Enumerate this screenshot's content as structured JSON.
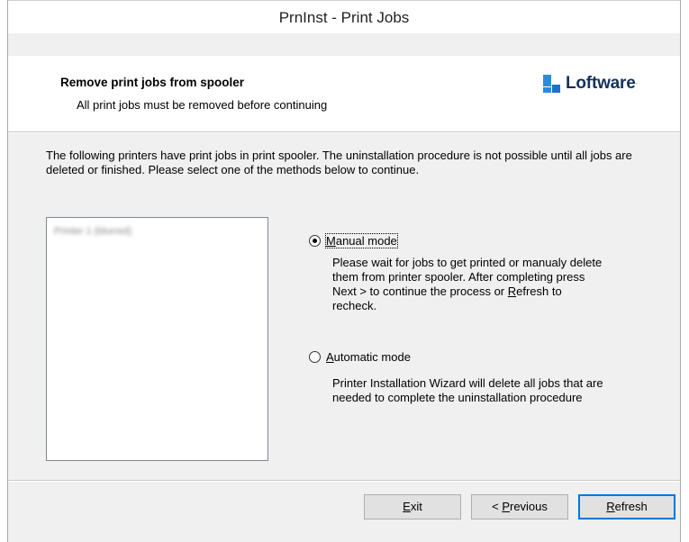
{
  "window": {
    "title": "PrnInst - Print Jobs"
  },
  "header": {
    "title": "Remove print jobs from spooler",
    "subtitle": "All print jobs must be removed before continuing",
    "logo_text": "Loftware",
    "logo_tm": "·"
  },
  "description": "The following printers have print jobs in print spooler. The uninstallation procedure is not possible until all jobs are deleted or finished. Please select one of the methods below to continue.",
  "printer_list": {
    "items": [
      "Printer 1 (blurred)"
    ]
  },
  "modes": {
    "manual": {
      "label_accel": "M",
      "label_rest": "anual mode",
      "checked": true,
      "desc_1": "Please wait for jobs to get printed or manualy delete",
      "desc_2": "them from printer spooler. After completing press",
      "desc_3a": "Next > to continue the process or ",
      "desc_3b": "R",
      "desc_3c": "efresh to",
      "desc_4": "recheck."
    },
    "automatic": {
      "label_accel": "A",
      "label_rest": "utomatic mode",
      "checked": false,
      "desc_1": "Printer Installation Wizard will delete all jobs that are",
      "desc_2": "needed to complete the uninstallation procedure"
    }
  },
  "buttons": {
    "exit_accel": "E",
    "exit_rest": "xit",
    "previous_prefix": "< ",
    "previous_accel": "P",
    "previous_rest": "revious",
    "refresh_accel": "R",
    "refresh_rest": "efresh"
  },
  "colors": {
    "accent": "#0078d7",
    "logo_blue": "#2d8ae0",
    "logo_text": "#16305b"
  }
}
